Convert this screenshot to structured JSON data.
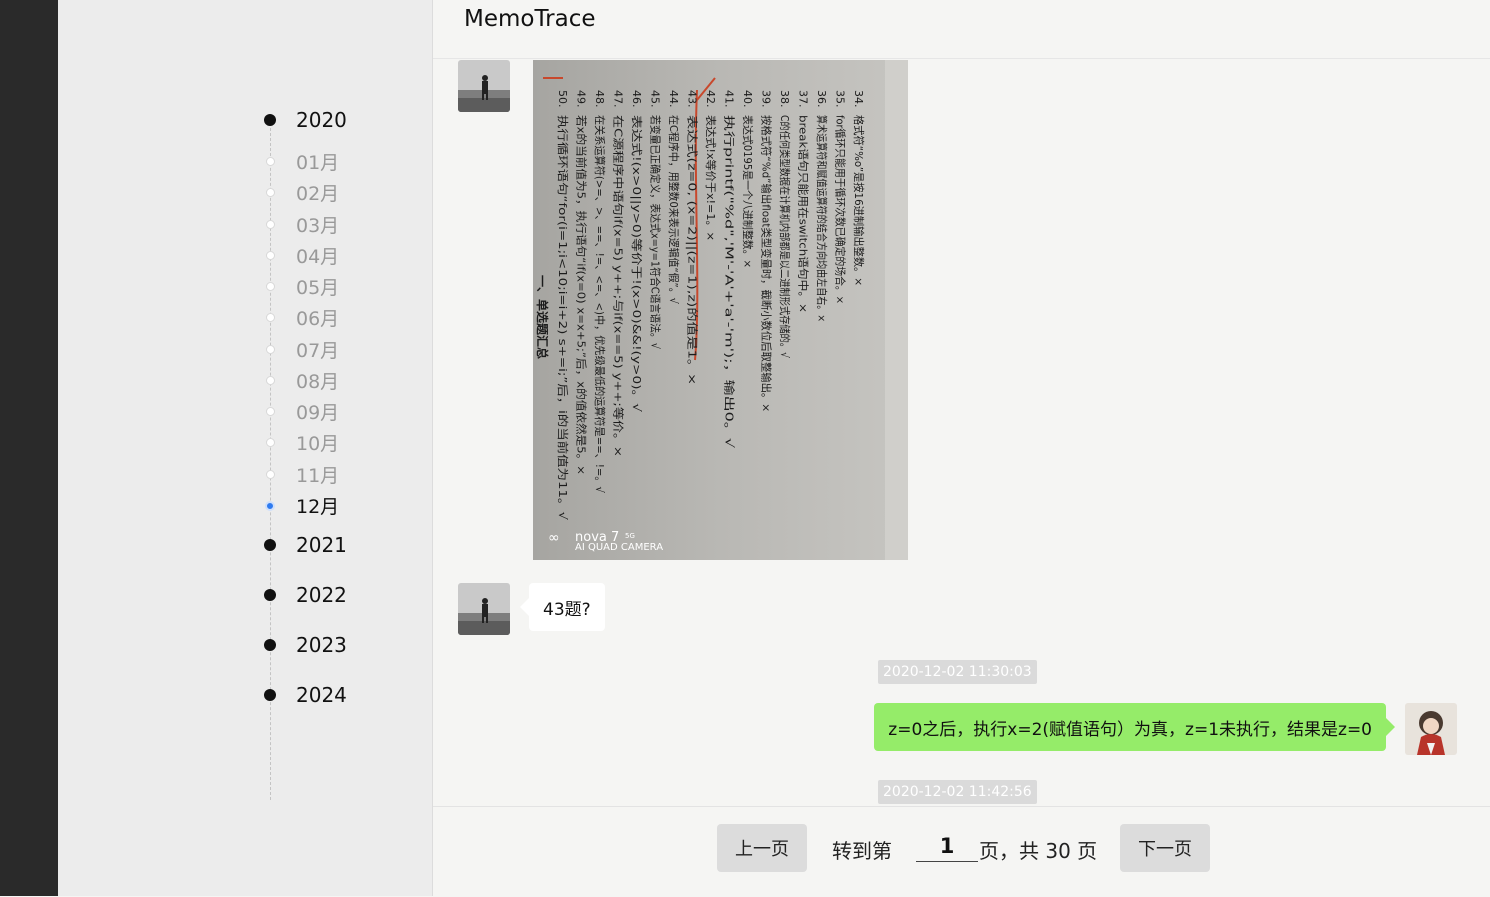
{
  "app": {
    "title": "MemoTrace"
  },
  "timeline": {
    "items": [
      {
        "label": "2020",
        "kind": "year"
      },
      {
        "label": "01月",
        "kind": "month"
      },
      {
        "label": "02月",
        "kind": "month"
      },
      {
        "label": "03月",
        "kind": "month"
      },
      {
        "label": "04月",
        "kind": "month"
      },
      {
        "label": "05月",
        "kind": "month"
      },
      {
        "label": "06月",
        "kind": "month"
      },
      {
        "label": "07月",
        "kind": "month"
      },
      {
        "label": "08月",
        "kind": "month"
      },
      {
        "label": "09月",
        "kind": "month"
      },
      {
        "label": "10月",
        "kind": "month"
      },
      {
        "label": "11月",
        "kind": "month"
      },
      {
        "label": "12月",
        "kind": "month-active"
      },
      {
        "label": "2021",
        "kind": "year"
      },
      {
        "label": "2022",
        "kind": "year"
      },
      {
        "label": "2023",
        "kind": "year"
      },
      {
        "label": "2024",
        "kind": "year"
      }
    ]
  },
  "chat": {
    "messages": [
      {
        "type": "image",
        "side": "left",
        "image": {
          "question_numbers": [
            "34.",
            "35.",
            "36.",
            "37.",
            "38.",
            "39.",
            "40.",
            "41.",
            "42.",
            "43.",
            "44.",
            "45.",
            "46.",
            "47.",
            "48.",
            "49.",
            "50."
          ],
          "lines": [
            "格式符“%o”是按16进制输出整数。×",
            "for循环只能用于循环次数已确定的场合。×",
            "算术运算符和赋值运算符的结合方向均由左自右。×",
            "break语句只能用在switch语句中。×",
            "C的任何类型数据在计算机内部都是以二进制形式存储的。√",
            "按格式符“%d”输出float类型变量时，截断小数位后取整输出。×",
            "表达式0195是一个八进制整数。×",
            "执行printf(\"%d\",'M'-'A'+'a'-'m');，输出0。√",
            "表达式!x等价于x!=1。×",
            "表达式(z=0, (x=2)||(z=1),z)的值是1。×",
            "在C程序中，用整数0来表示逻辑值“假”。√",
            "若变量已正确定义，表达式x=y=1符合C语言语法。√",
            "表达式!(x>0||y>0)等价于!(x>0)&&!(y>0)。√",
            "在C源程序中语句if(x=5) y++;与if(x==5) y++;等价。×",
            "在关系运算符(>=、>、==、!=、<=、<)中，优先级最低的运算符是==、!=。√",
            "若x的当前值为5，执行语句“if(x=0) x=x+5;”后，x的值依然是5。×",
            "执行循环语句“for(i=1;i<10;i=i+2) s+=i;”后，i的当前值为11。√"
          ],
          "section_heading": "一、单选题汇总",
          "watermark_brand": "nova 7",
          "watermark_suffix": "5G",
          "watermark_camera": "AI QUAD CAMERA"
        }
      },
      {
        "type": "text",
        "side": "left",
        "text": "43题?"
      },
      {
        "type": "timestamp",
        "text": "2020-12-02 11:30:03"
      },
      {
        "type": "text",
        "side": "right",
        "text": "z=0之后，执行x=2(赋值语句）为真，z=1未执行，结果是z=0"
      },
      {
        "type": "timestamp",
        "text": "2020-12-02 11:42:56"
      }
    ]
  },
  "pagination": {
    "prev_label": "上一页",
    "goto_prefix": "转到第",
    "current_page": "1",
    "goto_suffix": "页，共 30 页",
    "next_label": "下一页"
  },
  "colors": {
    "sidebar_dark": "#2a2a2a",
    "timeline_bg": "#ececec",
    "chat_bg": "#f5f5f3",
    "active_dot": "#2f7bf0",
    "sent_bubble": "#95ec69",
    "received_bubble": "#ffffff",
    "timestamp_bg": "#dadada",
    "page_button_bg": "#dcdcdc",
    "handwriting_red": "#c8482c"
  }
}
